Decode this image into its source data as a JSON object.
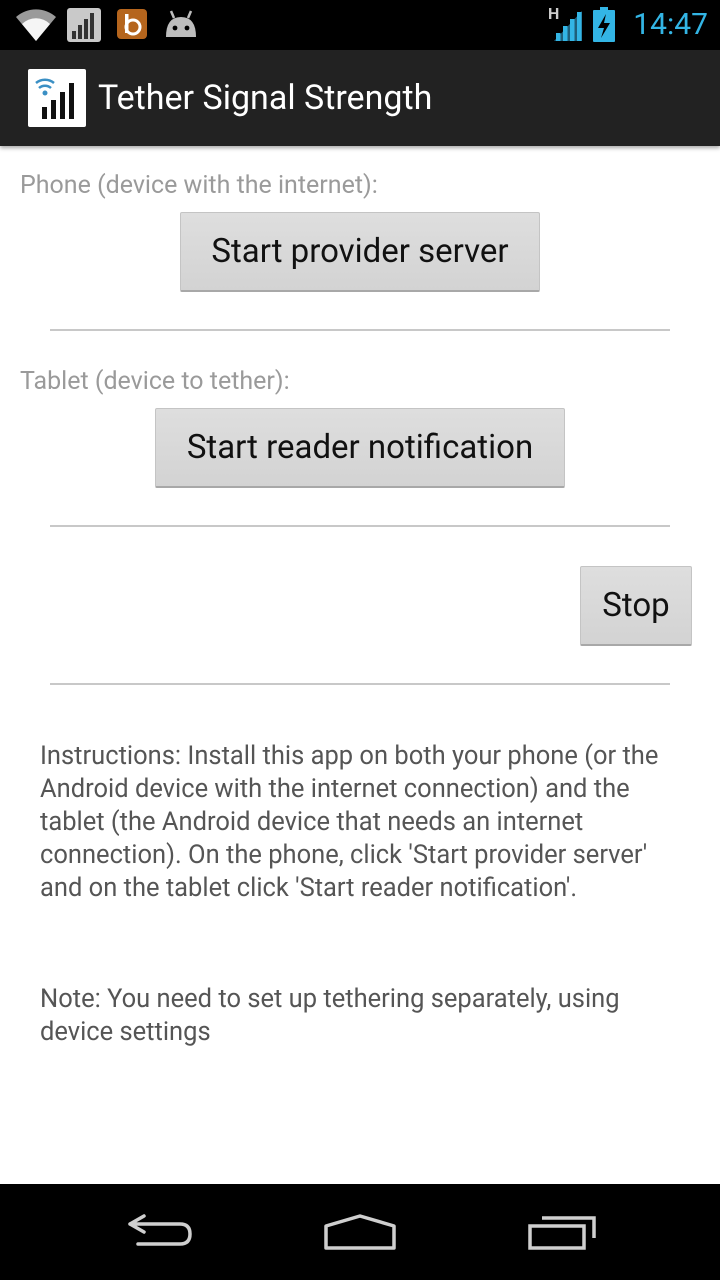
{
  "status_bar": {
    "time": "14:47",
    "network_type": "H",
    "icons": [
      "wifi-icon",
      "signal-bars-icon",
      "b-app-icon",
      "android-icon",
      "cell-signal-icon",
      "battery-charging-icon"
    ],
    "accent_color": "#33b5e5"
  },
  "action_bar": {
    "title": "Tether Signal Strength",
    "app_icon": "signal-strength-app-icon"
  },
  "phone_section": {
    "label": "Phone (device with the internet):",
    "button_label": "Start provider server"
  },
  "tablet_section": {
    "label": "Tablet (device to tether):",
    "button_label": "Start reader notification"
  },
  "stop_button_label": "Stop",
  "instructions": "Instructions: Install this app on both your phone (or the Android device with the internet connection) and the tablet (the Android device that needs an internet connection). On the phone, click 'Start provider server' and on the tablet click 'Start reader notification'.",
  "note": "Note: You need to set up tethering separately, using device settings",
  "nav_bar": {
    "icons": [
      "back-icon",
      "home-icon",
      "recents-icon"
    ]
  }
}
